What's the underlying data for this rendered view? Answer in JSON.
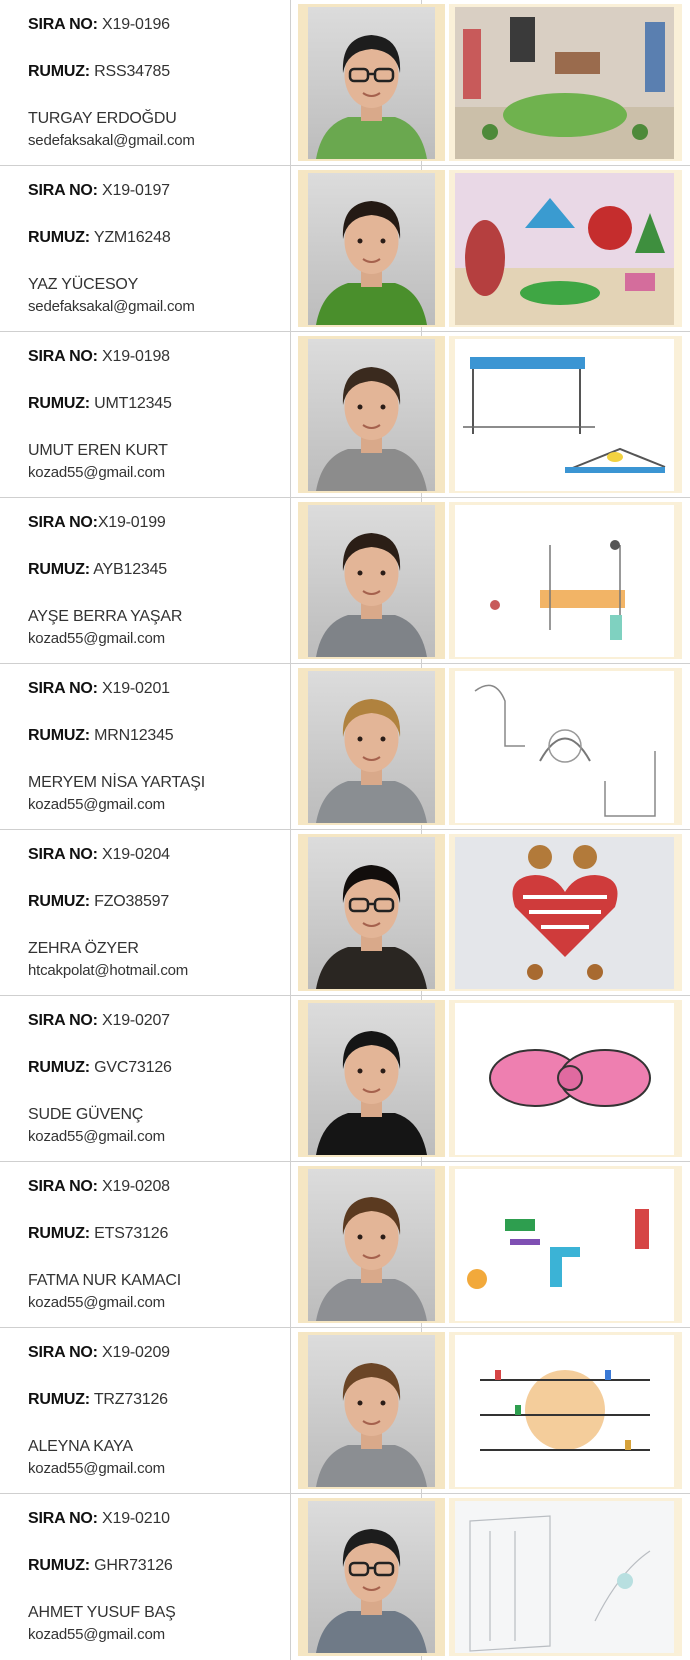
{
  "labels": {
    "sira": "SIRA NO:",
    "rumuz": "RUMUZ:"
  },
  "entries": [
    {
      "sira": " X19-0196",
      "rumuz": " RSS34785",
      "name": "TURGAY ERDOĞDU",
      "email": "sedefaksakal@gmail.com",
      "shirt": "#6aa84f",
      "hair": "#1d1d1d",
      "glasses": true,
      "drawing": "room"
    },
    {
      "sira": " X19-0197",
      "rumuz": " YZM16248",
      "name": "YAZ YÜCESOY",
      "email": "sedefaksakal@gmail.com",
      "shirt": "#4a8f2c",
      "hair": "#241a14",
      "glasses": false,
      "drawing": "garden"
    },
    {
      "sira": " X19-0198",
      "rumuz": " UMT12345",
      "name": "UMUT EREN KURT",
      "email": "kozad55@gmail.com",
      "shirt": "#8c8c8c",
      "hair": "#3a2a1e",
      "glasses": false,
      "drawing": "table"
    },
    {
      "sira": "X19-0199",
      "rumuz": " AYB12345",
      "name": "AYŞE BERRA YAŞAR",
      "email": "kozad55@gmail.com",
      "shirt": "#7f8388",
      "hair": "#2b1e16",
      "glasses": false,
      "drawing": "desk"
    },
    {
      "sira": " X19-0201",
      "rumuz": " MRN12345",
      "name": "MERYEM NİSA YARTAŞI",
      "email": "kozad55@gmail.com",
      "shirt": "#8a8e92",
      "hair": "#b0823e",
      "glasses": false,
      "drawing": "sketch"
    },
    {
      "sira": " X19-0204",
      "rumuz": " FZO38597",
      "name": "ZEHRA ÖZYER",
      "email": "htcakpolat@hotmail.com",
      "shirt": "#2a2622",
      "hair": "#120e0c",
      "glasses": true,
      "drawing": "heart"
    },
    {
      "sira": " X19-0207",
      "rumuz": " GVC73126",
      "name": "SUDE GÜVENÇ",
      "email": "kozad55@gmail.com",
      "shirt": "#151515",
      "hair": "#151515",
      "glasses": false,
      "drawing": "bow"
    },
    {
      "sira": " X19-0208",
      "rumuz": " ETS73126",
      "name": "FATMA NUR KAMACI",
      "email": "kozad55@gmail.com",
      "shirt": "#8d8f93",
      "hair": "#5b3a20",
      "glasses": false,
      "drawing": "letters"
    },
    {
      "sira": " X19-0209",
      "rumuz": " TRZ73126",
      "name": "ALEYNA KAYA",
      "email": "kozad55@gmail.com",
      "shirt": "#8b8e92",
      "hair": "#6b4526",
      "glasses": false,
      "drawing": "shelf"
    },
    {
      "sira": " X19-0210",
      "rumuz": " GHR73126",
      "name": "AHMET YUSUF BAŞ",
      "email": "kozad55@gmail.com",
      "shirt": "#6f7a87",
      "hair": "#1d1d1d",
      "glasses": true,
      "drawing": "faint"
    }
  ]
}
